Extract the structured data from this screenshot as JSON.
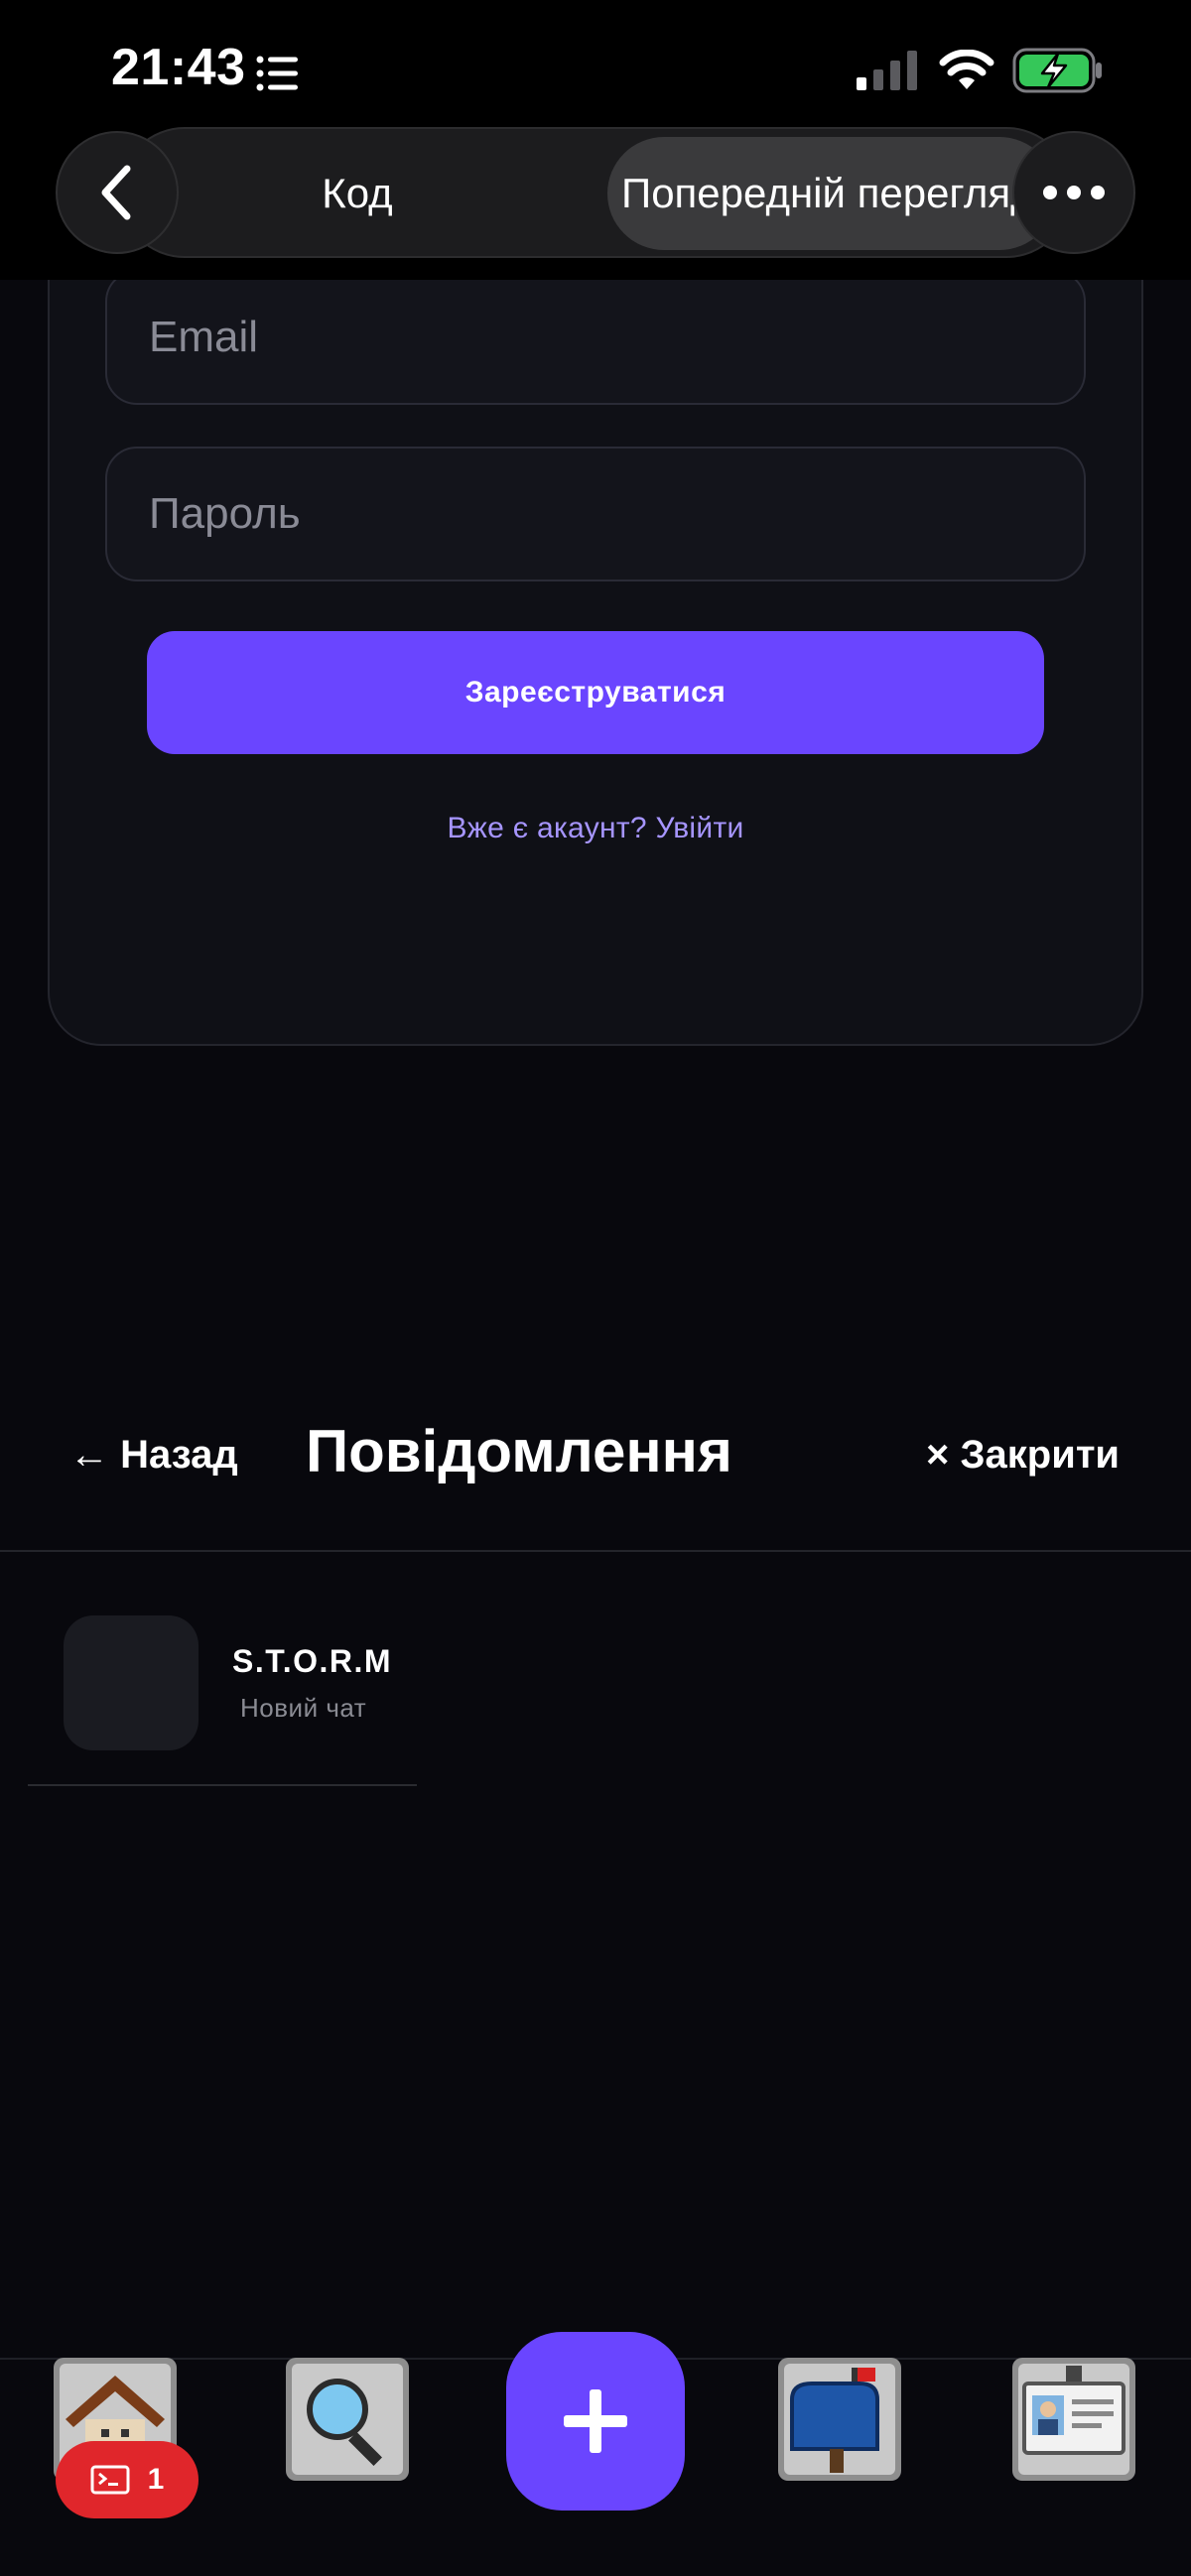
{
  "status_bar": {
    "time": "21:43"
  },
  "top_nav": {
    "tabs": [
      {
        "label": "Код",
        "active": false
      },
      {
        "label": "Попередній перегляд",
        "active": true
      }
    ]
  },
  "register_form": {
    "email_placeholder": "Email",
    "password_placeholder": "Пароль",
    "submit_label": "Зареєструватися",
    "login_link": "Вже є акаунт? Увійти"
  },
  "messages": {
    "back_label": "← Назад",
    "title": "Повідомлення",
    "close_label": "× Закрити",
    "chats": [
      {
        "name": "S.T.O.R.M",
        "subtitle": "Новий чат"
      }
    ]
  },
  "bottom_nav": {
    "items": [
      {
        "icon": "home-icon"
      },
      {
        "icon": "search-icon"
      },
      {
        "icon": "plus-icon"
      },
      {
        "icon": "mailbox-icon"
      },
      {
        "icon": "id-card-icon"
      }
    ],
    "terminal_badge_count": "1"
  },
  "colors": {
    "accent": "#6a45ff",
    "badge": "#e0262b",
    "link": "#a695ff",
    "background": "#08080d"
  }
}
